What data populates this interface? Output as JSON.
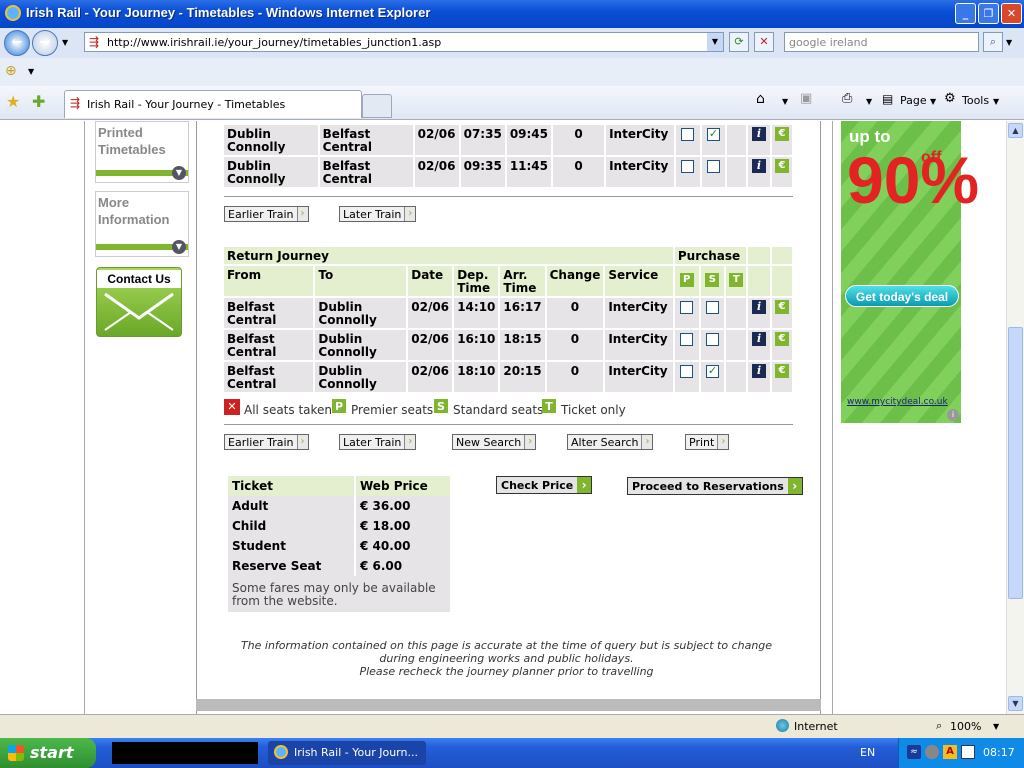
{
  "window": {
    "title": "Irish Rail - Your Journey - Timetables - Windows Internet Explorer"
  },
  "browser": {
    "url": "http://www.irishrail.ie/your_journey/timetables_junction1.asp",
    "search_placeholder": "google ireland",
    "tab_title": "Irish Rail - Your Journey - Timetables",
    "page_label": "Page",
    "tools_label": "Tools"
  },
  "sidebar": {
    "printed_timetables": "Printed Timetables",
    "more_information": "More Information",
    "contact_us": "Contact Us"
  },
  "outbound_rows": [
    {
      "from": "Dublin Connolly",
      "to": "Belfast Central",
      "date": "02/06",
      "dep": "07:35",
      "arr": "09:45",
      "change": "0",
      "service": "InterCity",
      "p": false,
      "s": true
    },
    {
      "from": "Dublin Connolly",
      "to": "Belfast Central",
      "date": "02/06",
      "dep": "09:35",
      "arr": "11:45",
      "change": "0",
      "service": "InterCity",
      "p": false,
      "s": false
    }
  ],
  "nav1": {
    "earlier": "Earlier Train",
    "later": "Later Train"
  },
  "return": {
    "title": "Return Journey",
    "purchase": "Purchase",
    "headers": {
      "from": "From",
      "to": "To",
      "date": "Date",
      "dep": "Dep. Time",
      "arr": "Arr. Time",
      "change": "Change",
      "service": "Service",
      "p": "P",
      "s": "S",
      "t": "T"
    },
    "rows": [
      {
        "from": "Belfast Central",
        "to": "Dublin Connolly",
        "date": "02/06",
        "dep": "14:10",
        "arr": "16:17",
        "change": "0",
        "service": "InterCity",
        "p": false,
        "s": false
      },
      {
        "from": "Belfast Central",
        "to": "Dublin Connolly",
        "date": "02/06",
        "dep": "16:10",
        "arr": "18:15",
        "change": "0",
        "service": "InterCity",
        "p": false,
        "s": false
      },
      {
        "from": "Belfast Central",
        "to": "Dublin Connolly",
        "date": "02/06",
        "dep": "18:10",
        "arr": "20:15",
        "change": "0",
        "service": "InterCity",
        "p": false,
        "s": true
      }
    ]
  },
  "legend": {
    "all_taken": "All seats taken",
    "premier": "Premier seats",
    "standard": "Standard seats",
    "ticket_only": "Ticket only"
  },
  "nav2": {
    "earlier": "Earlier Train",
    "later": "Later Train",
    "new_search": "New Search",
    "alter_search": "Alter Search",
    "print": "Print"
  },
  "prices": {
    "col_ticket": "Ticket",
    "col_price": "Web Price",
    "rows": [
      {
        "ticket": "Adult",
        "price": "€ 36.00"
      },
      {
        "ticket": "Child",
        "price": "€ 18.00"
      },
      {
        "ticket": "Student",
        "price": "€ 40.00"
      },
      {
        "ticket": "Reserve Seat",
        "price": "€ 6.00"
      }
    ],
    "note": "Some fares may only be available from the website."
  },
  "actions": {
    "check_price": "Check Price",
    "proceed": "Proceed to Reservations"
  },
  "disclaimer": {
    "line1": "The information contained on this page is accurate at the time of query but is subject to change",
    "line2": "during engineering works and public holidays.",
    "line3": "Please recheck the journey planner prior to travelling"
  },
  "ad": {
    "up_to": "up to",
    "percent": "90%",
    "off": "off",
    "cta": "Get today's deal",
    "site": "www.mycitydeal.co.uk"
  },
  "statusbar": {
    "zone": "Internet",
    "zoom": "100%"
  },
  "taskbar": {
    "start": "start",
    "item": "Irish Rail - Your Journ...",
    "lang": "EN",
    "time": "08:17"
  },
  "colors": {
    "accent_green": "#7fb62e",
    "header_bg": "#e3efcf",
    "row_bg": "#e6e4e6",
    "all_taken_red": "#cc2222"
  }
}
